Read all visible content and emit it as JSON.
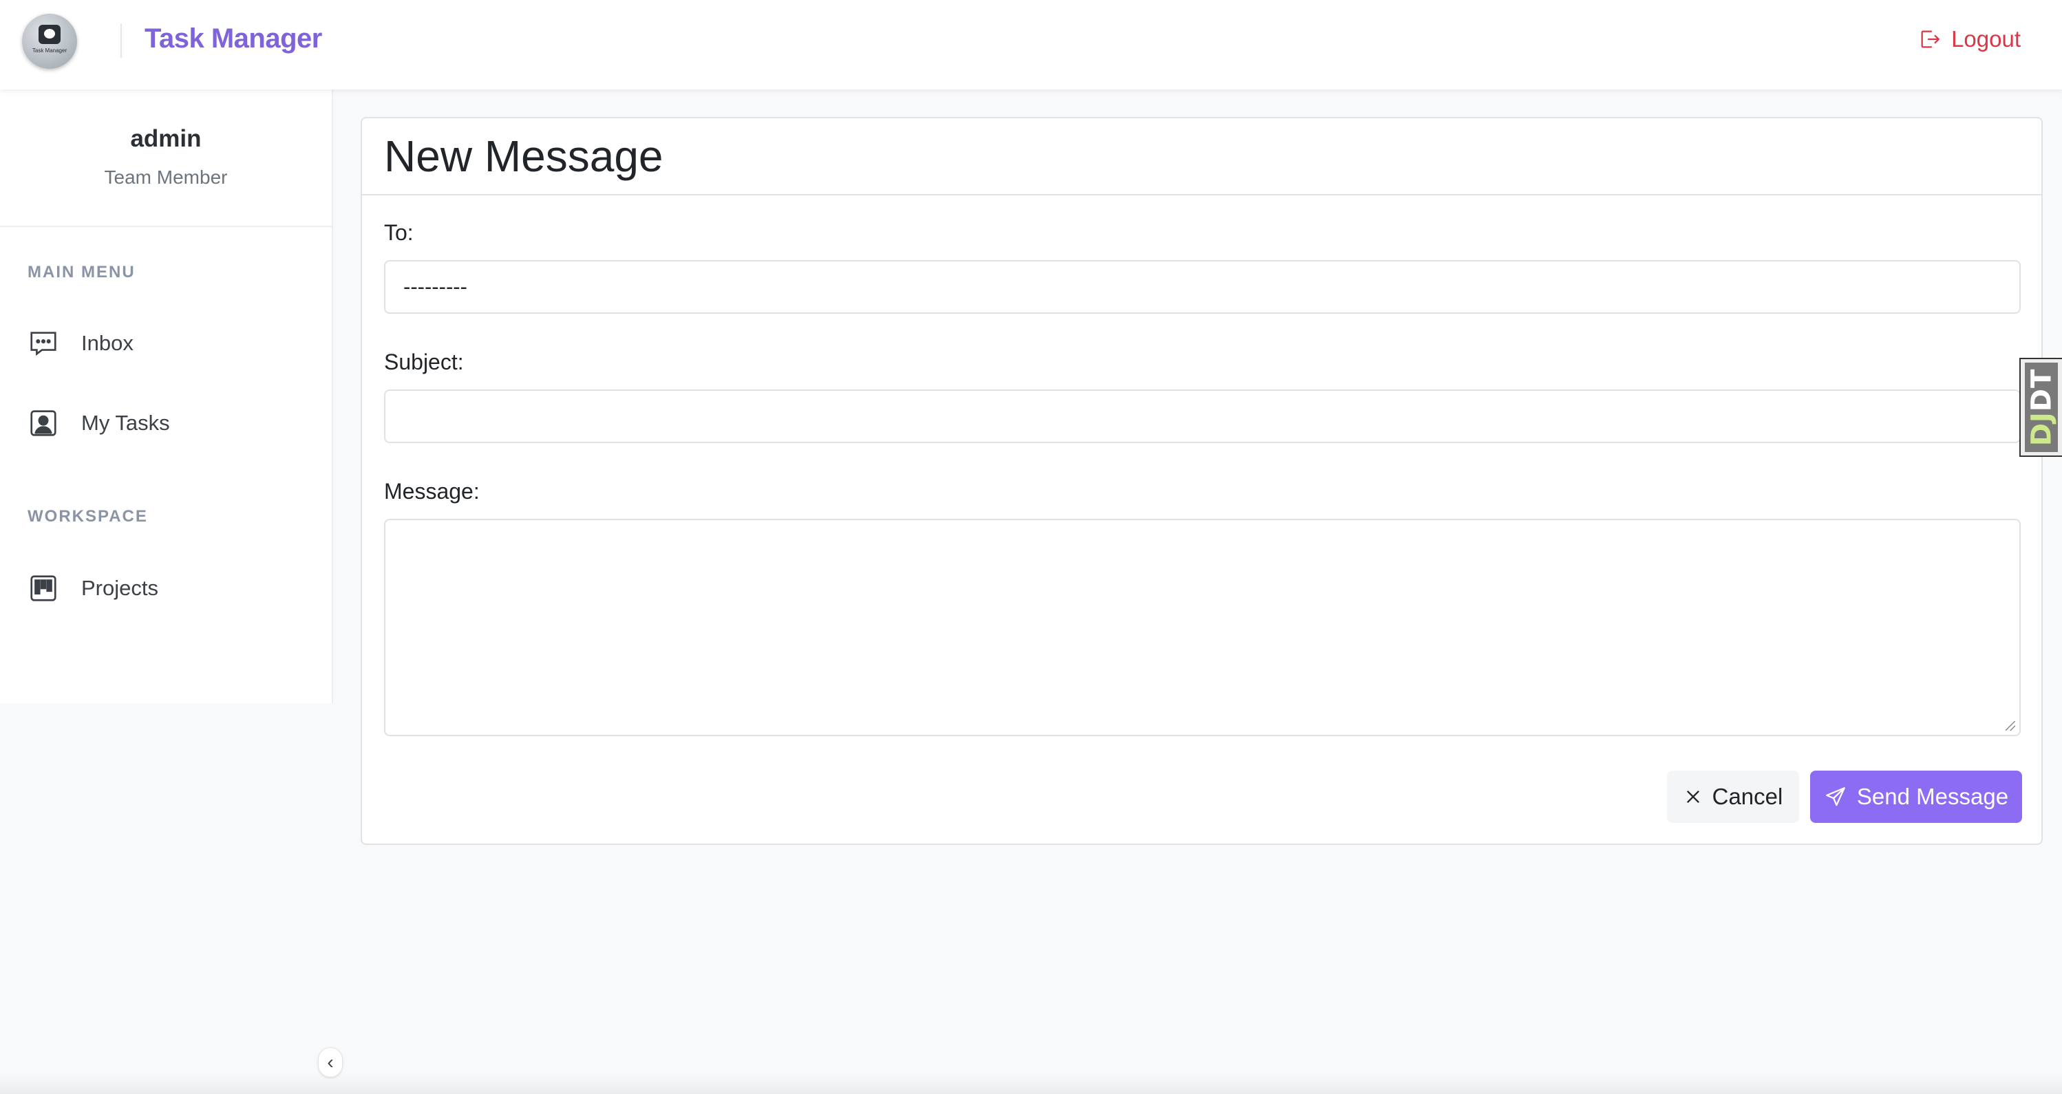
{
  "header": {
    "logo_text": "Task Manager",
    "brand": "Task Manager",
    "logout_label": "Logout"
  },
  "sidebar": {
    "user_name": "admin",
    "user_role": "Team Member",
    "sections": [
      {
        "title": "MAIN MENU",
        "items": [
          {
            "label": "Inbox",
            "icon": "chat-dots-icon"
          },
          {
            "label": "My Tasks",
            "icon": "person-badge-icon"
          }
        ]
      },
      {
        "title": "WORKSPACE",
        "items": [
          {
            "label": "Projects",
            "icon": "kanban-icon"
          }
        ]
      }
    ],
    "collapse_glyph": "‹"
  },
  "main": {
    "title": "New Message",
    "to_label": "To:",
    "to_value": "---------",
    "subject_label": "Subject:",
    "subject_value": "",
    "message_label": "Message:",
    "message_value": "",
    "cancel_label": "Cancel",
    "send_label": "Send Message"
  },
  "debug_toolbar": {
    "label_prefix": "DJ",
    "label_suffix": "DT"
  },
  "colors": {
    "brand": "#7e63d9",
    "primary_button": "#8b6cf2",
    "logout": "#dc3545"
  }
}
